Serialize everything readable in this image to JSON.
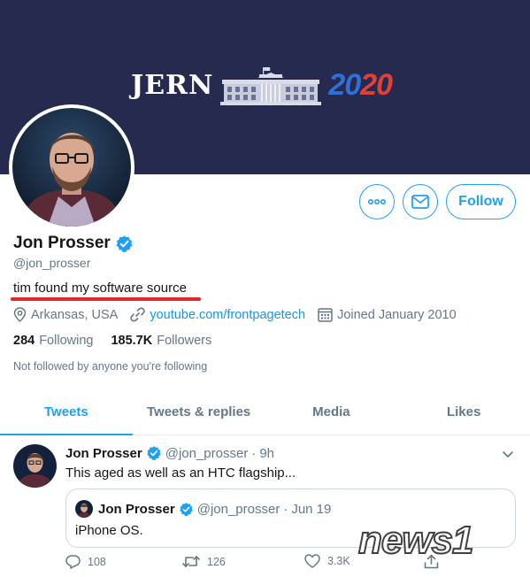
{
  "banner": {
    "brand_word": "JERN",
    "year_part1": "20",
    "year_part2": "20"
  },
  "profile": {
    "name": "Jon Prosser",
    "handle": "@jon_prosser",
    "bio": "tim found my software source",
    "location": "Arkansas, USA",
    "website": "youtube.com/frontpagetech",
    "joined": "Joined January 2010",
    "following_count": "284",
    "following_label": "Following",
    "followers_count": "185.7K",
    "followers_label": "Followers",
    "not_followed_text": "Not followed by anyone you're following"
  },
  "buttons": {
    "more_icon": "ellipsis-icon",
    "message_icon": "envelope-icon",
    "follow_label": "Follow"
  },
  "tabs": [
    {
      "label": "Tweets",
      "active": true
    },
    {
      "label": "Tweets & replies",
      "active": false
    },
    {
      "label": "Media",
      "active": false
    },
    {
      "label": "Likes",
      "active": false
    }
  ],
  "tweet": {
    "name": "Jon Prosser",
    "handle": "@jon_prosser",
    "separator": "·",
    "time": "9h",
    "text": "This aged as well as an HTC flagship...",
    "quote": {
      "name": "Jon Prosser",
      "handle": "@jon_prosser",
      "separator": "·",
      "time": "Jun 19",
      "text": "iPhone OS."
    },
    "actions": {
      "replies": "108",
      "retweets": "126",
      "likes": "3.3K"
    }
  },
  "watermark": {
    "text": "news1"
  },
  "colors": {
    "accent": "#1da1f2",
    "banner_bg": "#262a4f",
    "underline": "#e3262b",
    "muted_text": "#657786"
  }
}
